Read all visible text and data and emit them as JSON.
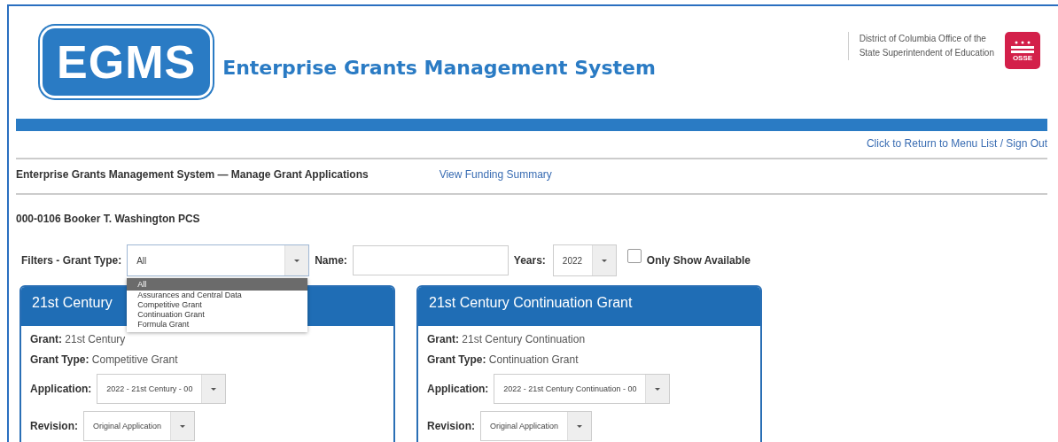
{
  "header": {
    "logo": "EGMS",
    "title": "Enterprise Grants Management System",
    "agency_lines": [
      "District of Columbia Office of the",
      "State Superintendent of Education"
    ],
    "agency_logo": "OSSE"
  },
  "menu_link": "Click to Return to Menu List / Sign Out",
  "page_heading": "Enterprise Grants Management System — Manage Grant Applications",
  "funding_link": "View Funding Summary",
  "organization": "000-0106 Booker T. Washington PCS",
  "filters": {
    "grant_type_label": "Filters - Grant Type:",
    "grant_type_value": "All",
    "expanded": true,
    "grant_type_options": [
      {
        "label": "All",
        "selected": true
      },
      {
        "label": "Assurances and Central Data",
        "selected": false
      },
      {
        "label": "Competitive Grant",
        "selected": false
      },
      {
        "label": "Continuation Grant",
        "selected": false
      },
      {
        "label": "Formula Grant",
        "selected": false
      }
    ],
    "name_label": "Name:",
    "years_label": "Years:",
    "years_value": "2022",
    "only_available_label": "Only Show Available",
    "only_available_checked": false
  },
  "cards": [
    {
      "title": "21st Century",
      "grant_label": "Grant:",
      "grant": "21st Century",
      "type_label": "Grant Type:",
      "grant_type": "Competitive Grant",
      "application_label": "Application:",
      "application": "2022 - 21st Century - 00",
      "revision_label": "Revision:",
      "revision": "Original Application"
    },
    {
      "title": "21st Century Continuation Grant",
      "grant_label": "Grant:",
      "grant": "21st Century Continuation",
      "type_label": "Grant Type:",
      "grant_type": "Continuation Grant",
      "application_label": "Application:",
      "application": "2022 - 21st Century Continuation - 00",
      "revision_label": "Revision:",
      "revision": "Original Application"
    }
  ]
}
